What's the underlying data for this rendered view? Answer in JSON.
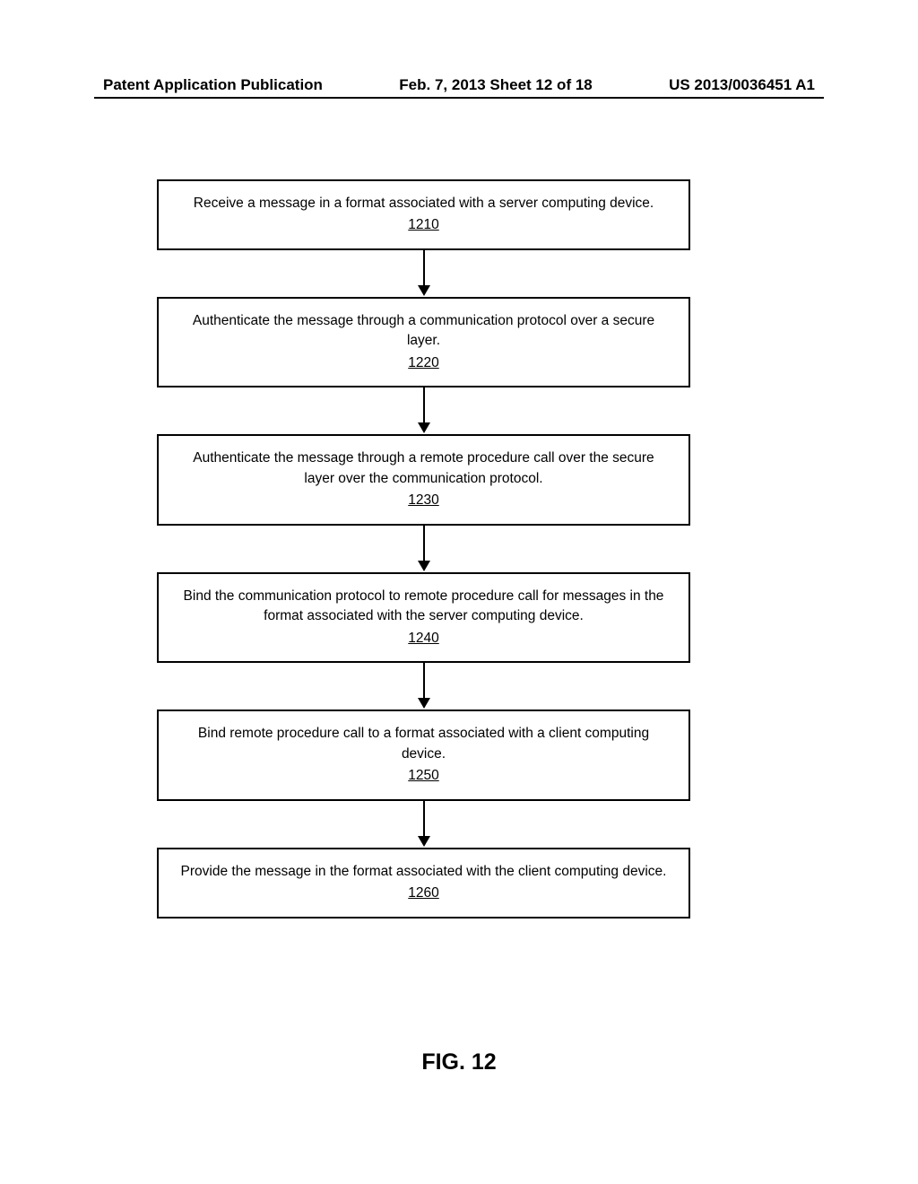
{
  "header": {
    "left": "Patent Application Publication",
    "center": "Feb. 7, 2013   Sheet 12 of 18",
    "right": "US 2013/0036451 A1"
  },
  "steps": [
    {
      "text": "Receive a message in a format associated with a server computing device.",
      "num": "1210"
    },
    {
      "text": "Authenticate the message through a communication protocol over a secure layer.",
      "num": "1220"
    },
    {
      "text": "Authenticate the message through a remote procedure call over the secure layer over the communication protocol.",
      "num": "1230"
    },
    {
      "text": "Bind the communication protocol to remote procedure call for messages in the format associated with the server computing device.",
      "num": "1240"
    },
    {
      "text": "Bind remote procedure call to a format associated with a client computing device.",
      "num": "1250"
    },
    {
      "text": "Provide the message in the format associated with the client computing device.",
      "num": "1260"
    }
  ],
  "figure_label": "FIG. 12"
}
